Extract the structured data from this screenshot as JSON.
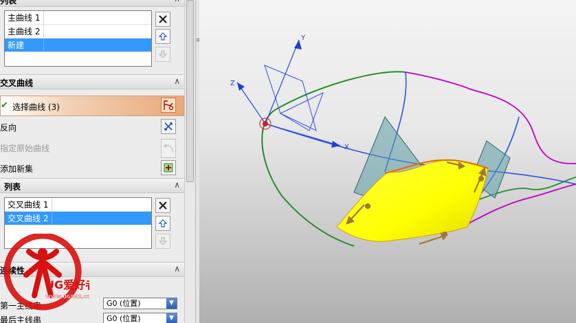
{
  "panel": {
    "spine_list": {
      "header": "列表",
      "items": [
        {
          "label": "主曲线 1",
          "selected": false
        },
        {
          "label": "主曲线 2",
          "selected": false
        },
        {
          "label": "新建",
          "selected": true
        }
      ]
    },
    "cross_curves": {
      "header": "交叉曲线",
      "select_curve_label": "选择曲线",
      "select_curve_count": "(3)",
      "reverse_label": "反向",
      "specify_origin_label": "指定原始曲线",
      "add_new_set_label": "添加新集"
    },
    "cross_list": {
      "header": "列表",
      "items": [
        {
          "label": "交叉曲线 1",
          "selected": false
        },
        {
          "label": "交叉曲线 2",
          "selected": true
        }
      ]
    },
    "continuity": {
      "header": "连续性",
      "first_spine_label": "第一主线串",
      "first_spine_value": "G0 (位置)",
      "last_spine_label": "最后主线串",
      "last_spine_value": "G0 (位置)"
    }
  },
  "viewport": {
    "axis_labels": {
      "x": "X",
      "y": "Y",
      "z": "Z"
    },
    "colors": {
      "green_curve": "#2a8a2a",
      "magenta_curve": "#c000c0",
      "blue_curve": "#3050e0",
      "surface": "#ffff00",
      "plane": "#5f9fa8"
    }
  },
  "watermark": {
    "brand": "UG爱好者",
    "url": "WWW.UGSNX.COM"
  }
}
